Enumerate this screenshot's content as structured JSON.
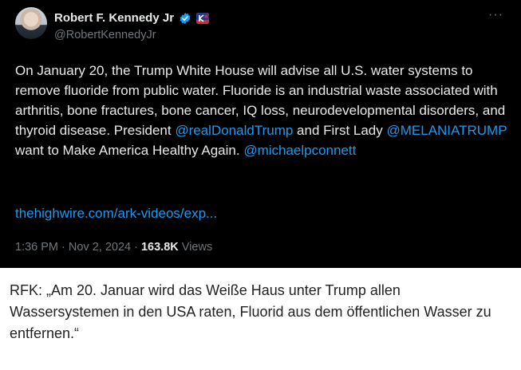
{
  "tweet": {
    "author_name": "Robert F. Kennedy Jr",
    "handle": "@RobertKennedyJr",
    "more_label": "···",
    "body": {
      "part1": "On January 20, the Trump White House will advise all U.S. water systems to remove fluoride from public water. Fluoride is an industrial waste associated with arthritis, bone fractures, bone cancer, IQ loss, neurodevelopmental disorders, and thyroid disease. President ",
      "mention1": "@realDonaldTrump",
      "part2": " and First Lady ",
      "mention2": "@MELANIATRUMP",
      "part3": " want to Make America Healthy Again. ",
      "mention3": "@michaelpconnett"
    },
    "link": "thehighwire.com/ark-videos/exp...",
    "meta": {
      "time": "1:36 PM",
      "sep1": " · ",
      "date": "Nov 2, 2024",
      "sep2": " · ",
      "views_count": "163.8K",
      "views_label": " Views"
    },
    "icons": {
      "verified": "verified-badge-icon",
      "flag": "campaign-flag-icon"
    },
    "colors": {
      "background": "#000000",
      "text": "#e7e9ea",
      "secondary": "#71767b",
      "link": "#1d9bf0"
    }
  },
  "caption": "RFK: „Am 20. Januar wird das Weiße Haus unter Trump allen Wassersystemen in den USA raten, Fluorid aus dem öffentlichen Wasser zu entfernen.“"
}
